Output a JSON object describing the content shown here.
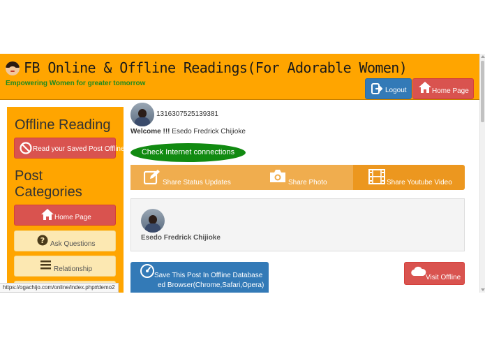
{
  "header": {
    "title": "FB Online & Offline Readings(For Adorable Women)",
    "subtitle": "Empowering Women for greater tomorrow",
    "logout_label": "Logout",
    "home_label": "Home Page",
    "bg_color": "#ffa500"
  },
  "sidebar": {
    "offline_heading": "Offline Reading",
    "read_saved_label": "Read your Saved Post Offline",
    "categories_heading": "Post Categories",
    "items": [
      {
        "label": "Home Page",
        "icon": "home-icon"
      },
      {
        "label": "Ask Questions",
        "icon": "question-circle-icon"
      },
      {
        "label": "Relationship",
        "icon": "menu-lines-icon"
      }
    ]
  },
  "main": {
    "user_id": "1316307525139381",
    "welcome_prefix": "Welcome !!!",
    "welcome_name": "Esedo Fredrick Chijioke",
    "check_internet_label": "Check Internet connections",
    "share": [
      {
        "label": "Share Status Updates",
        "icon": "edit-icon"
      },
      {
        "label": "Share Photo",
        "icon": "camera-icon"
      },
      {
        "label": "Share Youtube Video",
        "icon": "film-icon"
      }
    ],
    "post": {
      "author": "Esedo Fredrick Chijioke"
    },
    "save_button_line1": "Save This Post In Offline Database",
    "save_button_line2": "ed Browser(Chrome,Safari,Opera)",
    "visit_offline_label": "Visit Offline"
  },
  "status_bar": {
    "url": "https://ogachijo.com/online/index.php#demo2"
  },
  "colors": {
    "orange": "#ffa500",
    "green": "#118a11",
    "blue": "#337ab7",
    "red": "#d9534f"
  }
}
